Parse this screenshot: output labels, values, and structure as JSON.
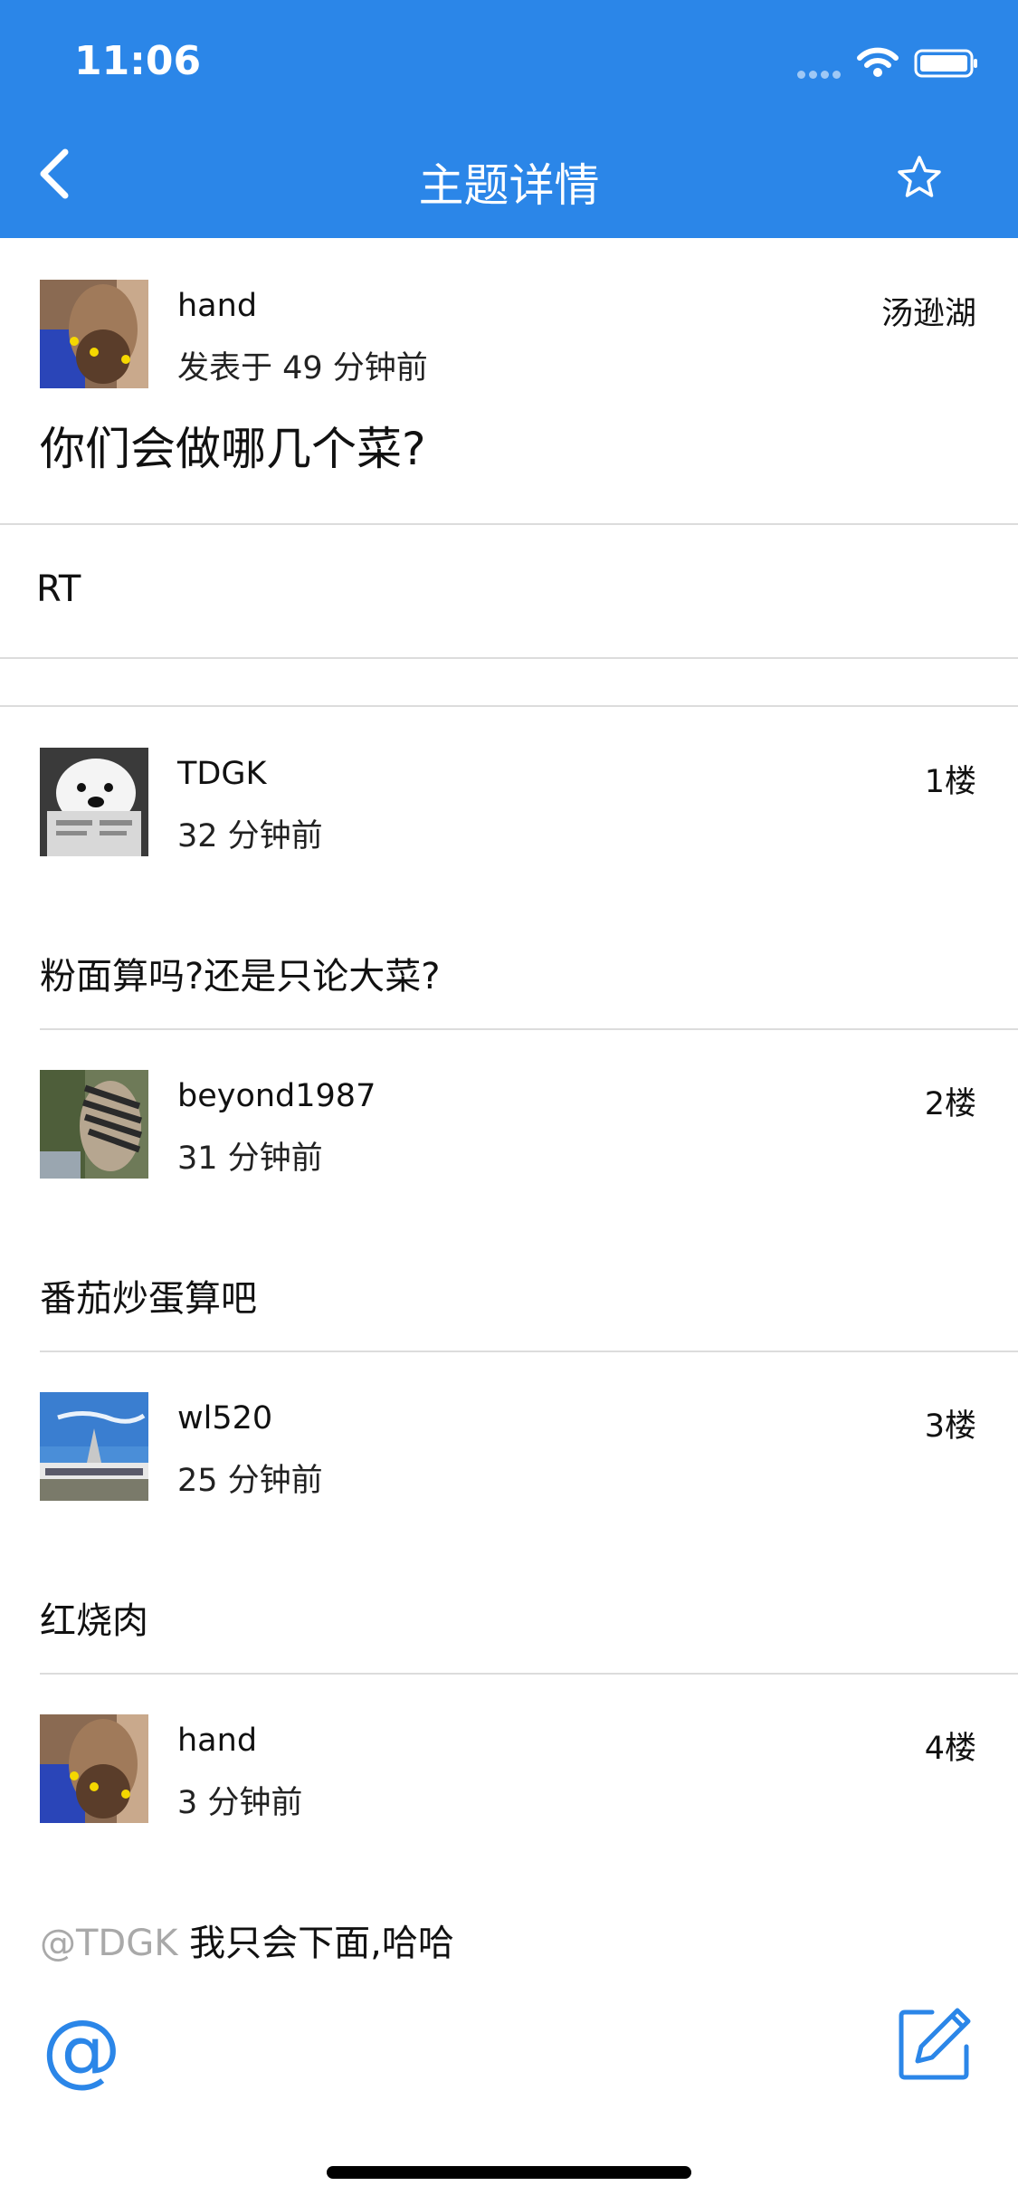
{
  "status_bar": {
    "time": "11:06"
  },
  "nav": {
    "title": "主题详情",
    "back_icon": "chevron-left-icon",
    "favorite_icon": "star-icon"
  },
  "topic": {
    "author": "hand",
    "posted": "发表于 49 分钟前",
    "node": "汤逊湖",
    "title": "你们会做哪几个菜?",
    "body": "RT"
  },
  "replies": [
    {
      "user": "TDGK",
      "time": "32 分钟前",
      "floor": "1楼",
      "mention": "",
      "text": "粉面算吗?还是只论大菜?"
    },
    {
      "user": "beyond1987",
      "time": "31 分钟前",
      "floor": "2楼",
      "mention": "",
      "text": "番茄炒蛋算吧"
    },
    {
      "user": "wl520",
      "time": "25 分钟前",
      "floor": "3楼",
      "mention": "",
      "text": "红烧肉"
    },
    {
      "user": "hand",
      "time": "3 分钟前",
      "floor": "4楼",
      "mention": "@TDGK",
      "text": " 我只会下面,哈哈"
    }
  ],
  "toolbar": {
    "at_label": "@",
    "edit_icon": "edit-icon"
  },
  "colors": {
    "accent": "#2b86e8",
    "mention": "#a9a9a9"
  }
}
